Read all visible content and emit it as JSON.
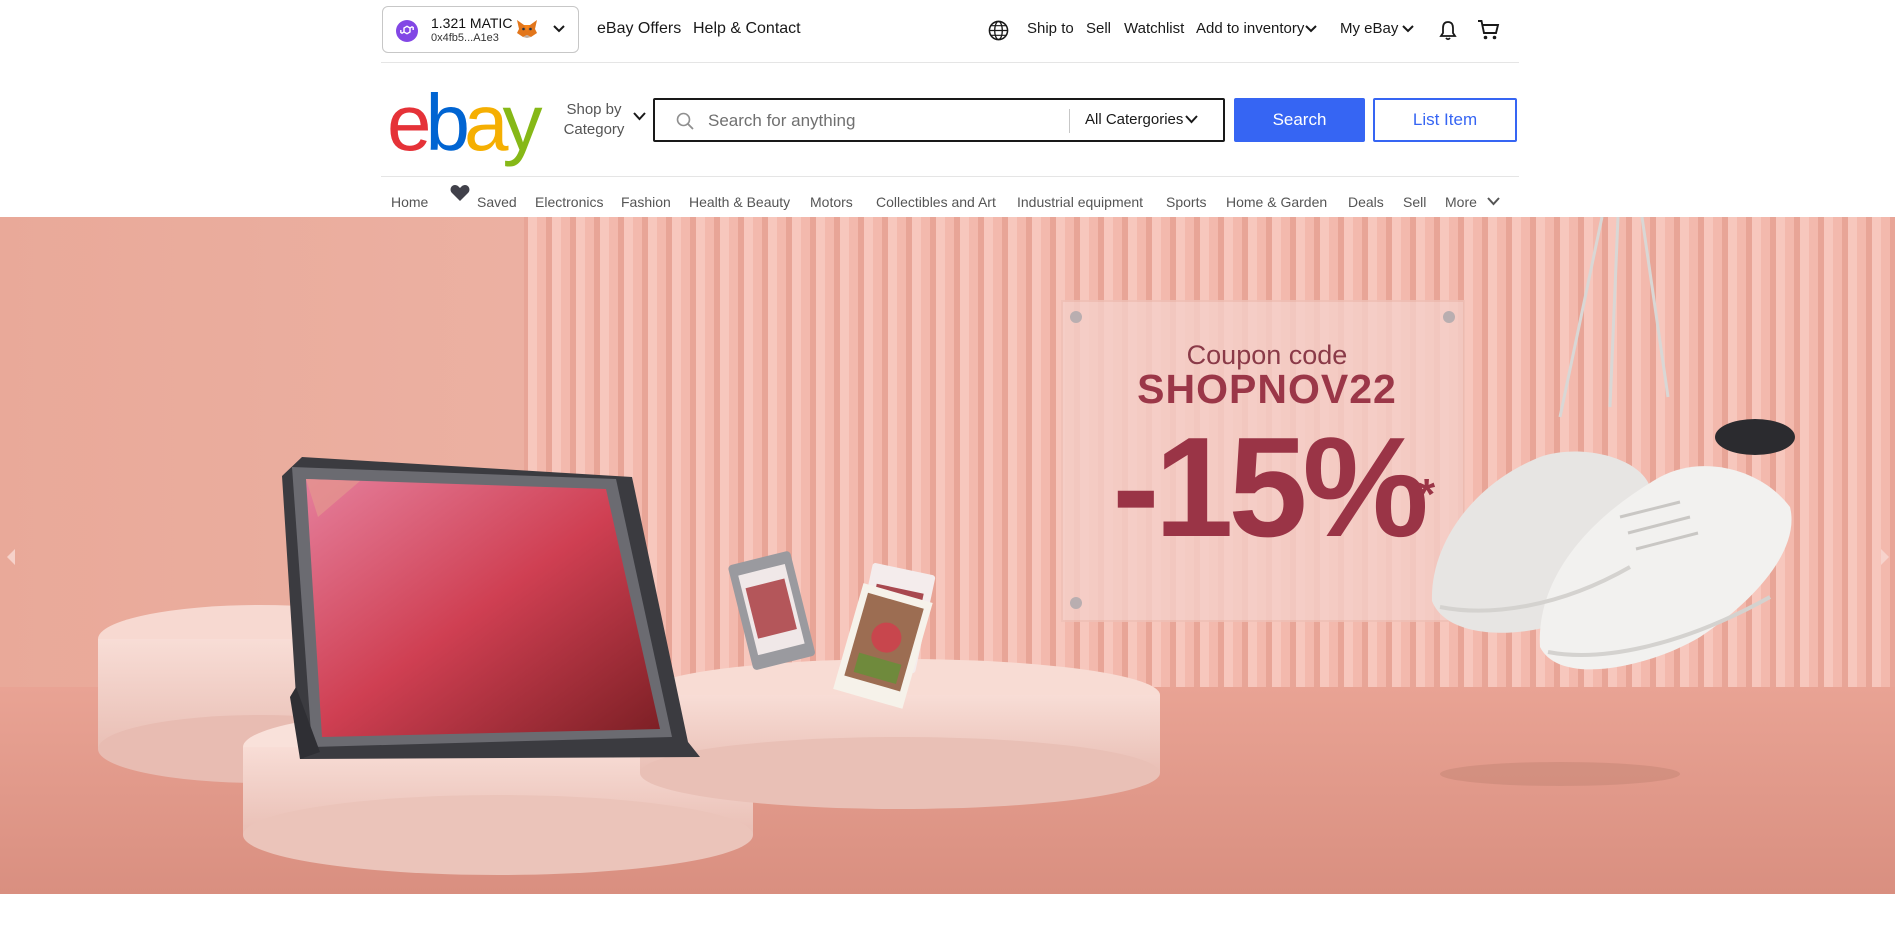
{
  "wallet": {
    "balance": "1.321 MATIC",
    "address": "0x4fb5...A1e3"
  },
  "top_links": {
    "offers": "eBay Offers",
    "help": "Help & Contact",
    "ship_to": "Ship to",
    "sell": "Sell",
    "watchlist": "Watchlist",
    "add_inventory": "Add to inventory",
    "my_ebay": "My eBay"
  },
  "icons": [
    "globe-icon",
    "bell-icon",
    "cart-icon",
    "search-icon",
    "chevron-down-icon",
    "heart-icon",
    "metamask-fox-icon",
    "polygon-icon"
  ],
  "logo": {
    "letters": [
      "e",
      "b",
      "a",
      "y"
    ],
    "colors": [
      "#e53238",
      "#0064d2",
      "#f5af02",
      "#86b817"
    ]
  },
  "header": {
    "shop_by_category": "Shop by Category",
    "search_placeholder": "Search for anything",
    "category_select": "All Catergories",
    "search_button": "Search",
    "list_button": "List Item"
  },
  "nav": [
    "Home",
    "Saved",
    "Electronics",
    "Fashion",
    "Health & Beauty",
    "Motors",
    "Collectibles and Art",
    "Industrial equipment",
    "Sports",
    "Home & Garden",
    "Deals",
    "Sell",
    "More"
  ],
  "hero": {
    "coupon_title": "Coupon code",
    "coupon_code": "SHOPNOV22",
    "discount": "-15%",
    "asterisk": "*"
  },
  "colors": {
    "accent": "#3665f3",
    "hero_bg": "#f0b7ab",
    "coupon_text": "#9a3446"
  }
}
